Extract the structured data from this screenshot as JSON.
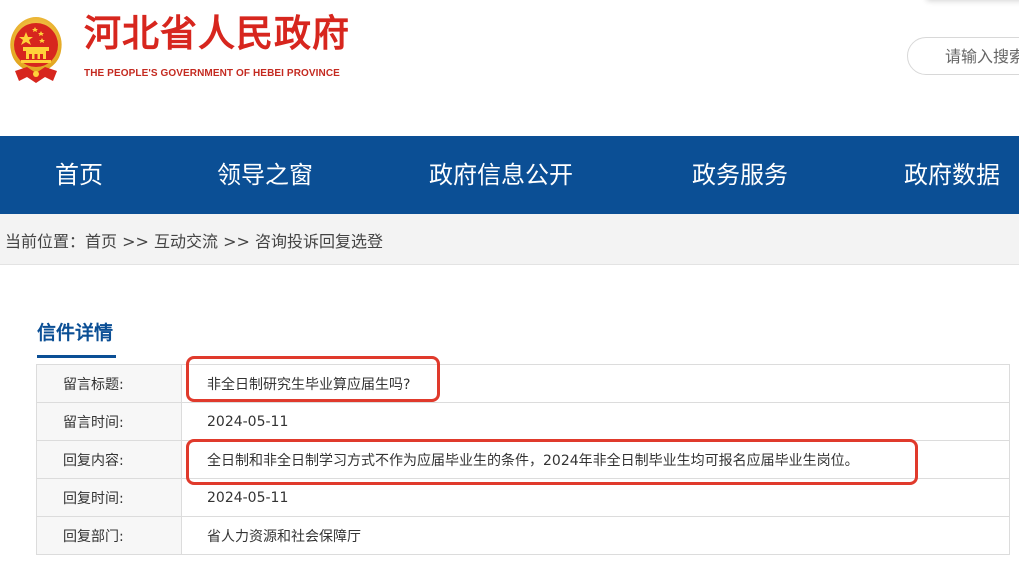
{
  "header": {
    "brand_cn": "河北省人民政府",
    "brand_en": "THE PEOPLE'S GOVERNMENT OF HEBEI PROVINCE",
    "search_placeholder": "请输入搜索"
  },
  "nav": {
    "items": [
      "首页",
      "领导之窗",
      "政府信息公开",
      "政务服务",
      "政府数据"
    ]
  },
  "breadcrumb": {
    "prefix": "当前位置：",
    "items": [
      "首页",
      "互动交流",
      "咨询投诉回复选登"
    ],
    "separator": " >> "
  },
  "section": {
    "title": "信件详情"
  },
  "detail": {
    "rows": [
      {
        "label": "留言标题:",
        "value": "非全日制研究生毕业算应届生吗?"
      },
      {
        "label": "留言时间:",
        "value": "2024-05-11"
      },
      {
        "label": "回复内容:",
        "value": "全日制和非全日制学习方式不作为应届毕业生的条件，2024年非全日制毕业生均可报名应届毕业生岗位。"
      },
      {
        "label": "回复时间:",
        "value": "2024-05-11"
      },
      {
        "label": "回复部门:",
        "value": "省人力资源和社会保障厅"
      }
    ]
  },
  "colors": {
    "nav_bg": "#0b4f95",
    "brand_red": "#d7261e",
    "highlight_red": "#e03a2c",
    "title_blue": "#0b4f95"
  },
  "icons": {
    "emblem": "national-emblem-icon"
  }
}
